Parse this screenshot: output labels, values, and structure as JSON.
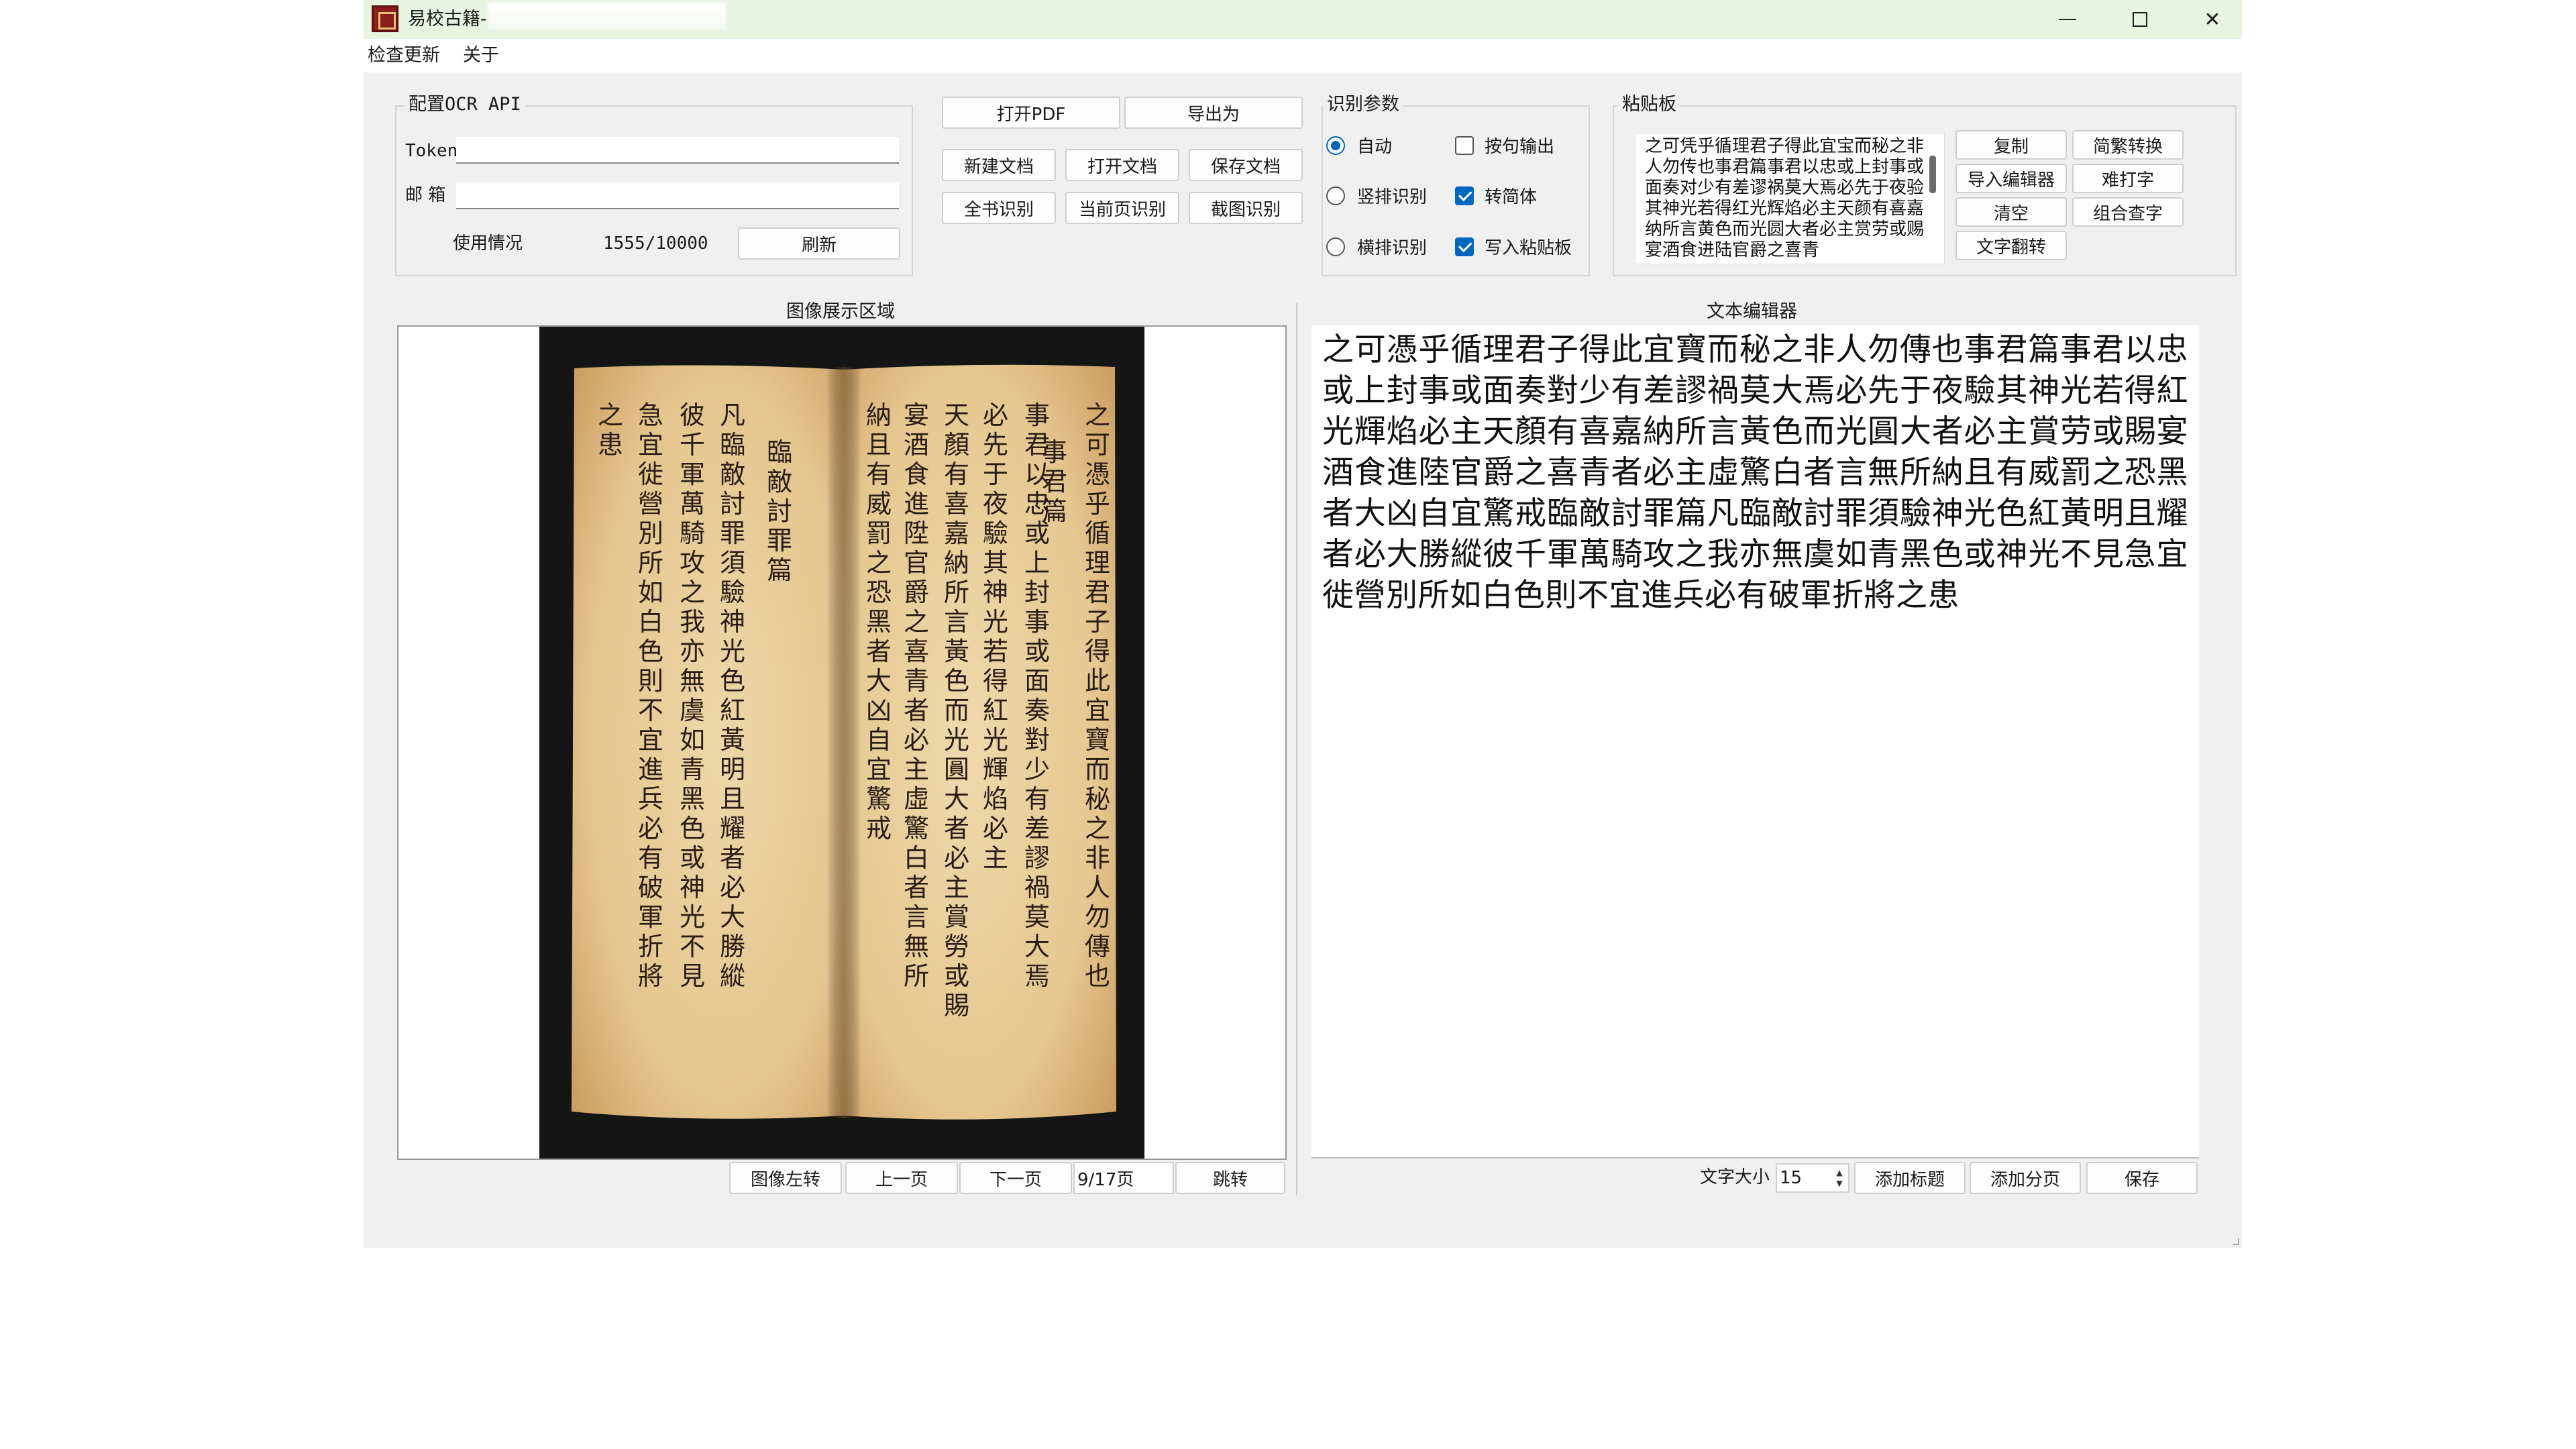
{
  "window": {
    "title": "易校古籍-",
    "controls": {
      "minimize": "minimize-icon",
      "maximize": "maximize-icon",
      "close": "close-icon"
    }
  },
  "menu": [
    "检查更新",
    "关于"
  ],
  "ocr_config": {
    "title": "配置OCR API",
    "token_label": "Token",
    "email_label": "邮 箱",
    "usage_label": "使用情况",
    "usage_value": "1555/10000",
    "refresh": "刷新"
  },
  "toolbar": {
    "open_pdf": "打开PDF",
    "export_as": "导出为",
    "new_doc": "新建文档",
    "open_doc": "打开文档",
    "save_doc": "保存文档",
    "ocr_all": "全书识别",
    "ocr_page": "当前页识别",
    "ocr_capture": "截图识别"
  },
  "params": {
    "title": "识别参数",
    "radio_auto": "自动",
    "radio_vertical": "竖排识别",
    "radio_horizontal": "横排识别",
    "selected_radio": "自动",
    "chk_sentence": "按句输出",
    "chk_simplified": "转简体",
    "chk_clipboard": "写入粘贴板",
    "chk_sentence_checked": false,
    "chk_simplified_checked": true,
    "chk_clipboard_checked": true
  },
  "clipboard": {
    "title": "粘贴板",
    "text": "之可凭乎循理君子得此宜宝而秘之非人勿传也事君篇事君以忠或上封事或面奏对少有差谬祸莫大焉必先于夜验其神光若得红光辉焰必主天颜有喜嘉纳所言黄色而光圆大者必主赏劳或赐宴酒食进陆官爵之喜青",
    "copy": "复制",
    "convert": "简繁转换",
    "import": "导入编辑器",
    "hard_char": "难打字",
    "clear": "清空",
    "combine": "组合查字",
    "flip": "文字翻转"
  },
  "image_panel": {
    "title": "图像展示区域",
    "rotate_left": "图像左转",
    "prev": "上一页",
    "next": "下一页",
    "page": "9/17页",
    "jump": "跳转"
  },
  "book_columns": [
    "之可憑乎循理君子得此宜寶而秘之非人勿傳也",
    "事君篇",
    "事君以忠或上封事或面奏對少有差謬禍莫大焉",
    "必先于夜驗其神光若得紅光輝焰必主",
    "天顏有喜嘉納所言黃色而光圓大者必主賞勞或賜",
    "宴酒食進陞官爵之喜青者必主虛驚白者言無所",
    "納且有威罰之恐黑者大凶自宜驚戒",
    "臨敵討罪篇",
    "凡臨敵討罪須驗神光色紅黃明且耀者必大勝縱",
    "彼千軍萬騎攻之我亦無虞如青黑色或神光不見",
    "急宜徙營別所如白色則不宜進兵必有破軍折將",
    "之患"
  ],
  "editor": {
    "title": "文本编辑器",
    "text": "之可憑乎循理君子得此宜寶而秘之非人勿傳也事君篇事君以忠或上封事或面奏對少有差謬禍莫大焉必先于夜驗其神光若得紅光輝焰必主天顏有喜嘉納所言黃色而光圓大者必主賞劳或賜宴酒食進陸官爵之喜青者必主虛驚白者言無所納且有威罰之恐黑者大凶自宜驚戒臨敵討罪篇凡臨敵討罪須驗神光色紅黃明且耀者必大勝縱彼千軍萬騎攻之我亦無虞如青黑色或神光不見急宜徙營別所如白色則不宜進兵必有破軍折將之患",
    "font_size_label": "文字大小",
    "font_size": "15",
    "add_title": "添加标题",
    "add_page": "添加分页",
    "save": "保存"
  },
  "colors": {
    "accent": "#0067c0",
    "titlebar": "#e8f3e0",
    "page": "#e9cf9e",
    "ink": "#2b1d14"
  }
}
